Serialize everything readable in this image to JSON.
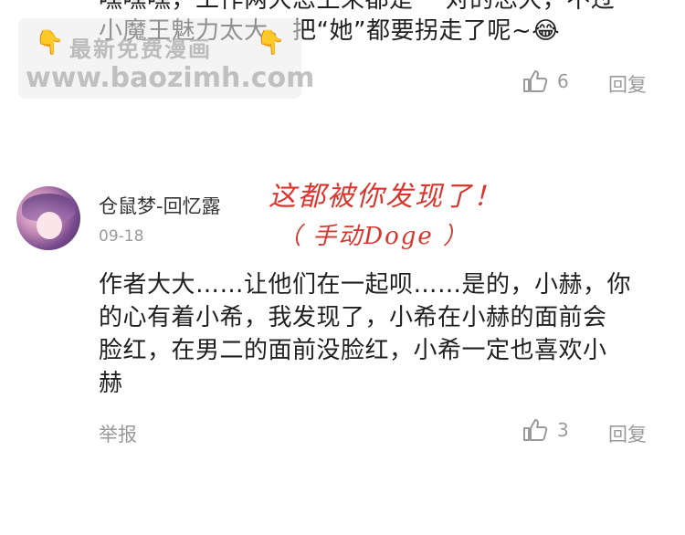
{
  "watermark": {
    "line1": "最新免费漫画",
    "line2": "www.baozimh.com",
    "hand": "👇"
  },
  "prev_comment": {
    "line1": "嘿嘿嘿，工作两大忌上来都是 一对的忘大，不过",
    "line2": "小魔王魅力太大，把“她”都要拐走了呢~",
    "emoji": "😂",
    "likes": "6",
    "reply_label": "回复"
  },
  "comment": {
    "username": "仓鼠梦-回忆露",
    "date": "09-18",
    "text_lines": [
      "作者大大……让他们在一起呗……是的，小赫，你",
      "的心有着小希，我发现了，小希在小赫的面前会",
      "脸红，在男二的面前没脸红，小希一定也喜欢小",
      "赫"
    ],
    "report_label": "举报",
    "likes": "3",
    "reply_label": "回复"
  },
  "annotation": {
    "line1": "这都被你发现了！",
    "line2": "（ 手动Doge ）"
  },
  "colors": {
    "text": "#1f1f1f",
    "meta": "#9a9a9a",
    "annotation_red": "#d8352c"
  }
}
